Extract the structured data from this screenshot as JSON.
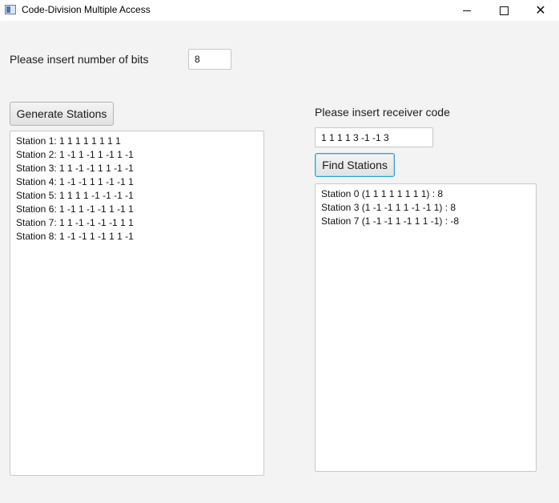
{
  "window": {
    "title": "Code-Division Multiple Access"
  },
  "left": {
    "bits_label": "Please insert number of bits",
    "bits_value": "8",
    "generate_button": "Generate Stations",
    "stations": [
      "Station 1: 1 1 1 1 1 1 1 1",
      "Station 2: 1 -1 1 -1 1 -1 1 -1",
      "Station 3: 1 1 -1 -1 1 1 -1 -1",
      "Station 4: 1 -1 -1 1 1 -1 -1 1",
      "Station 5: 1 1 1 1 -1 -1 -1 -1",
      "Station 6: 1 -1 1 -1 -1 1 -1 1",
      "Station 7: 1 1 -1 -1 -1 -1 1 1",
      "Station 8: 1 -1 -1 1 -1 1 1 -1"
    ]
  },
  "right": {
    "receiver_label": "Please insert receiver code",
    "receiver_value": "1 1 1 1 3 -1 -1 3",
    "find_button": "Find Stations",
    "results": [
      "Station 0 (1 1 1 1 1 1 1 1) : 8",
      "Station 3 (1 -1 -1 1 1 -1 -1 1) : 8",
      "Station 7 (1 -1 -1 1 -1 1 1 -1) : -8"
    ]
  }
}
